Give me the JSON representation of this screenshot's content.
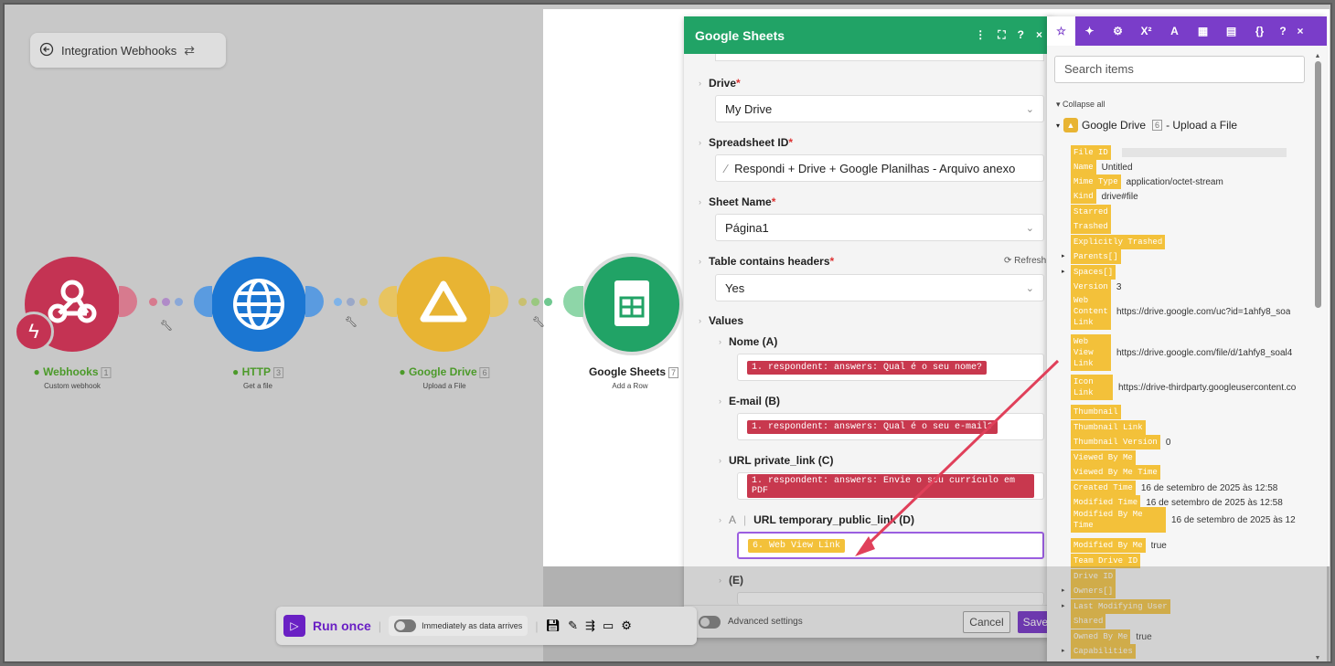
{
  "canvas": {
    "back_label": "Integration Webhooks",
    "modules": [
      {
        "name": "Webhooks",
        "num": "1",
        "sub": "Custom webhook",
        "color": "#c43353"
      },
      {
        "name": "HTTP",
        "num": "3",
        "sub": "Get a file",
        "color": "#1b76d2"
      },
      {
        "name": "Google Drive",
        "num": "6",
        "sub": "Upload a File",
        "color": "#e8b433"
      },
      {
        "name": "Google Sheets",
        "num": "7",
        "sub": "Add a Row",
        "color": "#21a366"
      }
    ]
  },
  "gsheets": {
    "title": "Google Sheets",
    "drive_label": "Drive",
    "drive_value": "My Drive",
    "spreadsheet_label": "Spreadsheet ID",
    "spreadsheet_value": "Respondi + Drive + Google Planilhas - Arquivo anexo",
    "sheet_label": "Sheet Name",
    "sheet_value": "Página1",
    "headers_label": "Table contains headers",
    "refresh": "Refresh",
    "headers_value": "Yes",
    "values_label": "Values",
    "col_a_label": "Nome (A)",
    "col_a_pill": "1. respondent: answers: Qual é o seu nome?",
    "col_b_label": "E-mail (B)",
    "col_b_pill": "1. respondent: answers: Qual é o seu e-mail?",
    "col_c_label": "URL private_link (C)",
    "col_c_pill": "1. respondent: answers: Envie o seu currículo em PDF",
    "col_d_label": "URL temporary_public_link (D)",
    "col_d_pill": "6. Web View Link",
    "col_e_label": "(E)",
    "advanced": "Advanced settings",
    "cancel": "Cancel",
    "save": "Save"
  },
  "picker": {
    "search_placeholder": "Search items",
    "collapse": "Collapse all",
    "module_name": "Google Drive",
    "module_num": "6",
    "module_action": "- Upload a File",
    "items": [
      {
        "k": "File ID",
        "v": ""
      },
      {
        "k": "Name",
        "v": "Untitled"
      },
      {
        "k": "Mime Type",
        "v": "application/octet-stream"
      },
      {
        "k": "Kind",
        "v": "drive#file"
      },
      {
        "k": "Starred",
        "v": ""
      },
      {
        "k": "Trashed",
        "v": ""
      },
      {
        "k": "Explicitly Trashed",
        "v": ""
      },
      {
        "k": "Parents[]",
        "v": ""
      },
      {
        "k": "Spaces[]",
        "v": ""
      },
      {
        "k": "Version",
        "v": "3"
      },
      {
        "k": "Web Content Link",
        "v": "https://drive.google.com/uc?id=1ahfy8_soa"
      },
      {
        "k": "Web View Link",
        "v": "https://drive.google.com/file/d/1ahfy8_soal4"
      },
      {
        "k": "Icon Link",
        "v": "https://drive-thirdparty.googleusercontent.co"
      },
      {
        "k": "Thumbnail",
        "v": ""
      },
      {
        "k": "Thumbnail Link",
        "v": ""
      },
      {
        "k": "Thumbnail Version",
        "v": "0"
      },
      {
        "k": "Viewed By Me",
        "v": ""
      },
      {
        "k": "Viewed By Me Time",
        "v": ""
      },
      {
        "k": "Created Time",
        "v": "16 de setembro de 2025 às 12:58"
      },
      {
        "k": "Modified Time",
        "v": "16 de setembro de 2025 às 12:58"
      },
      {
        "k": "Modified By Me Time",
        "v": "16 de setembro de 2025 às 12"
      },
      {
        "k": "Modified By Me",
        "v": "true"
      },
      {
        "k": "Team Drive ID",
        "v": ""
      },
      {
        "k": "Drive ID",
        "v": ""
      },
      {
        "k": "Owners[]",
        "v": ""
      },
      {
        "k": "Last Modifying User",
        "v": ""
      },
      {
        "k": "Shared",
        "v": ""
      },
      {
        "k": "Owned By Me",
        "v": "true"
      },
      {
        "k": "Capabilities",
        "v": ""
      }
    ]
  },
  "toolbar": {
    "run_once": "Run once",
    "schedule": "Immediately as data arrives"
  }
}
